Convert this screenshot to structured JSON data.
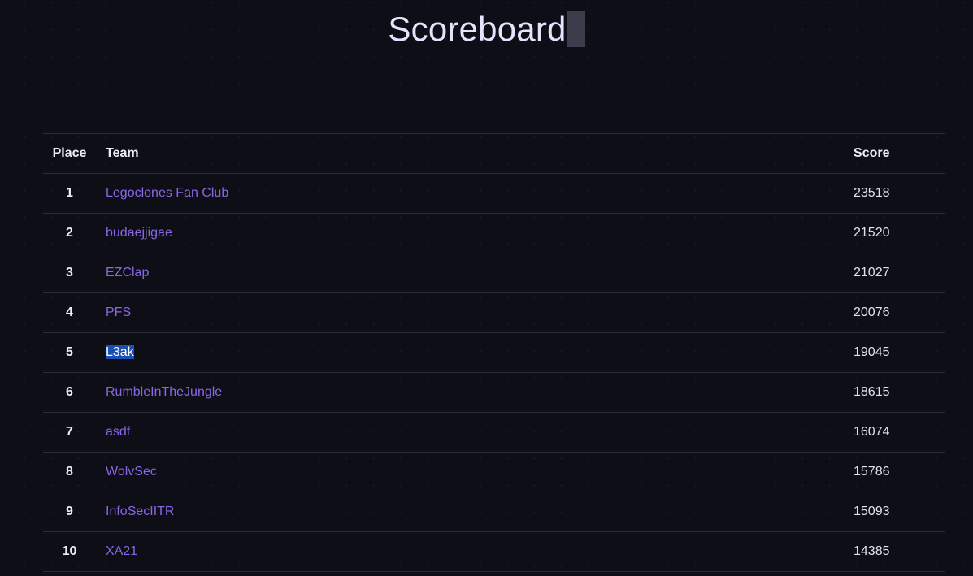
{
  "page": {
    "title": "Scoreboard"
  },
  "table": {
    "headers": {
      "place": "Place",
      "team": "Team",
      "score": "Score"
    },
    "rows": [
      {
        "place": "1",
        "team": "Legoclones Fan Club",
        "score": "23518"
      },
      {
        "place": "2",
        "team": "budaejjigae",
        "score": "21520"
      },
      {
        "place": "3",
        "team": "EZClap",
        "score": "21027"
      },
      {
        "place": "4",
        "team": "PFS",
        "score": "20076"
      },
      {
        "place": "5",
        "team": "L3ak",
        "score": "19045",
        "highlighted": true
      },
      {
        "place": "6",
        "team": "RumbleInTheJungle",
        "score": "18615"
      },
      {
        "place": "7",
        "team": "asdf",
        "score": "16074"
      },
      {
        "place": "8",
        "team": "WolvSec",
        "score": "15786"
      },
      {
        "place": "9",
        "team": "InfoSecIITR",
        "score": "15093"
      },
      {
        "place": "10",
        "team": "XA21",
        "score": "14385"
      }
    ]
  },
  "colors": {
    "background": "#0d0e16",
    "team_link": "#8b66e6",
    "selection_highlight": "#1a4fb5"
  }
}
